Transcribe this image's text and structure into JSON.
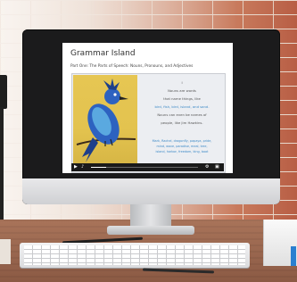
{
  "app": {
    "title": "Grammar Island",
    "subtitle": "Part One: The Parts of Speech: Nouns, Pronouns, and Adjectives"
  },
  "poem": {
    "lines": [
      {
        "text": "I",
        "color": "#555555"
      },
      {
        "text": "Nouns are words",
        "color": "#555555"
      },
      {
        "text": "that name things, like",
        "color": "#555555"
      },
      {
        "text": "bird, fish, bird, island, and sand.",
        "color": "#3e8ac7"
      },
      {
        "text": "Nouns can even be names of",
        "color": "#555555"
      },
      {
        "text": "people, like Jim Hawkins.",
        "color": "#555555"
      }
    ],
    "wordlist": [
      "Mark, Rachel, dragonfly, papaya, pride,",
      "mind, wave, paradise, meal, tree,",
      "island, harbor, freedom, king, boat"
    ]
  },
  "player": {
    "progress": 0.14,
    "controls": {
      "play_icon": "play-icon",
      "volume_icon": "volume-icon",
      "settings_icon": "settings-icon",
      "fullscreen_icon": "fullscreen-icon"
    }
  },
  "colors": {
    "accent": "#3e8ac7",
    "bird_blue": "#2d62c0",
    "artwork_bg": "#e3c34f"
  }
}
